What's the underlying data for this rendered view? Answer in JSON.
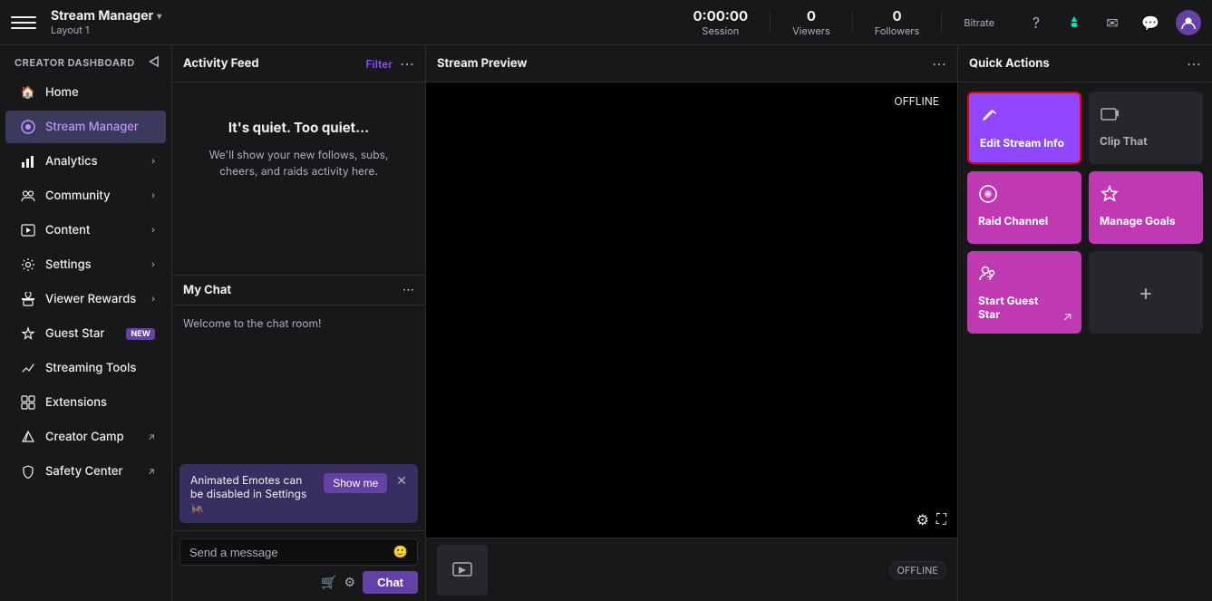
{
  "topNav": {
    "hamburger_label": "Menu",
    "app_title": "Stream Manager",
    "app_subtitle": "Layout 1",
    "chevron": "▾",
    "stats": [
      {
        "value": "0:00:00",
        "label": "Session"
      },
      {
        "value": "0",
        "label": "Viewers"
      },
      {
        "value": "0",
        "label": "Followers"
      },
      {
        "value": "",
        "label": "Bitrate"
      }
    ]
  },
  "sidebar": {
    "header": "CREATOR DASHBOARD",
    "collapse_title": "Collapse sidebar",
    "items": [
      {
        "id": "home",
        "label": "Home",
        "icon": "🏠",
        "has_chevron": false,
        "active": false,
        "external": false,
        "badge": null
      },
      {
        "id": "stream-manager",
        "label": "Stream Manager",
        "icon": "📡",
        "has_chevron": false,
        "active": true,
        "external": false,
        "badge": null
      },
      {
        "id": "analytics",
        "label": "Analytics",
        "icon": "📊",
        "has_chevron": true,
        "active": false,
        "external": false,
        "badge": null
      },
      {
        "id": "community",
        "label": "Community",
        "icon": "👥",
        "has_chevron": true,
        "active": false,
        "external": false,
        "badge": null
      },
      {
        "id": "content",
        "label": "Content",
        "icon": "🎬",
        "has_chevron": true,
        "active": false,
        "external": false,
        "badge": null
      },
      {
        "id": "settings",
        "label": "Settings",
        "icon": "⚙️",
        "has_chevron": true,
        "active": false,
        "external": false,
        "badge": null
      },
      {
        "id": "viewer-rewards",
        "label": "Viewer Rewards",
        "icon": "🎁",
        "has_chevron": true,
        "active": false,
        "external": false,
        "badge": null
      },
      {
        "id": "guest-star",
        "label": "Guest Star",
        "icon": "⭐",
        "has_chevron": false,
        "active": false,
        "external": false,
        "badge": "NEW"
      },
      {
        "id": "streaming-tools",
        "label": "Streaming Tools",
        "icon": "🛠",
        "has_chevron": false,
        "active": false,
        "external": false,
        "badge": null
      },
      {
        "id": "extensions",
        "label": "Extensions",
        "icon": "🧩",
        "has_chevron": false,
        "active": false,
        "external": false,
        "badge": null
      },
      {
        "id": "creator-camp",
        "label": "Creator Camp",
        "icon": "🏕",
        "has_chevron": false,
        "active": false,
        "external": true,
        "badge": null
      },
      {
        "id": "safety-center",
        "label": "Safety Center",
        "icon": "🛡",
        "has_chevron": false,
        "active": false,
        "external": true,
        "badge": null
      }
    ]
  },
  "activityFeed": {
    "title": "Activity Feed",
    "filter_label": "Filter",
    "empty_title": "It's quiet. Too quiet...",
    "empty_sub": "We'll show your new follows, subs,\ncheers, and raids activity here."
  },
  "myChat": {
    "title": "My Chat",
    "welcome_msg": "Welcome to the chat room!",
    "notification_text": "Animated Emotes can be disabled in Settings 🦗",
    "show_me_label": "Show me",
    "input_placeholder": "Send a message",
    "chat_button_label": "Chat"
  },
  "streamPreview": {
    "title": "Stream Preview",
    "offline_text": "OFFLINE",
    "offline_pill": "OFFLINE"
  },
  "quickActions": {
    "title": "Quick Actions",
    "cards": [
      {
        "id": "edit-stream-info",
        "label": "Edit Stream Info",
        "icon": "✏️",
        "style": "purple",
        "selected": true,
        "arrow": null
      },
      {
        "id": "clip-that",
        "label": "Clip That",
        "icon": "🎬",
        "style": "empty-icon",
        "selected": false,
        "arrow": null
      },
      {
        "id": "raid-channel",
        "label": "Raid Channel",
        "icon": "📡",
        "style": "pink",
        "selected": false,
        "arrow": null
      },
      {
        "id": "manage-goals",
        "label": "Manage Goals",
        "icon": "⭐",
        "style": "pink",
        "selected": false,
        "arrow": null
      },
      {
        "id": "start-guest-star",
        "label": "Start Guest\nStar",
        "icon": "👥",
        "style": "pink",
        "selected": false,
        "arrow": "↗"
      },
      {
        "id": "add-more",
        "label": "",
        "icon": "+",
        "style": "empty",
        "selected": false,
        "arrow": null
      }
    ]
  }
}
